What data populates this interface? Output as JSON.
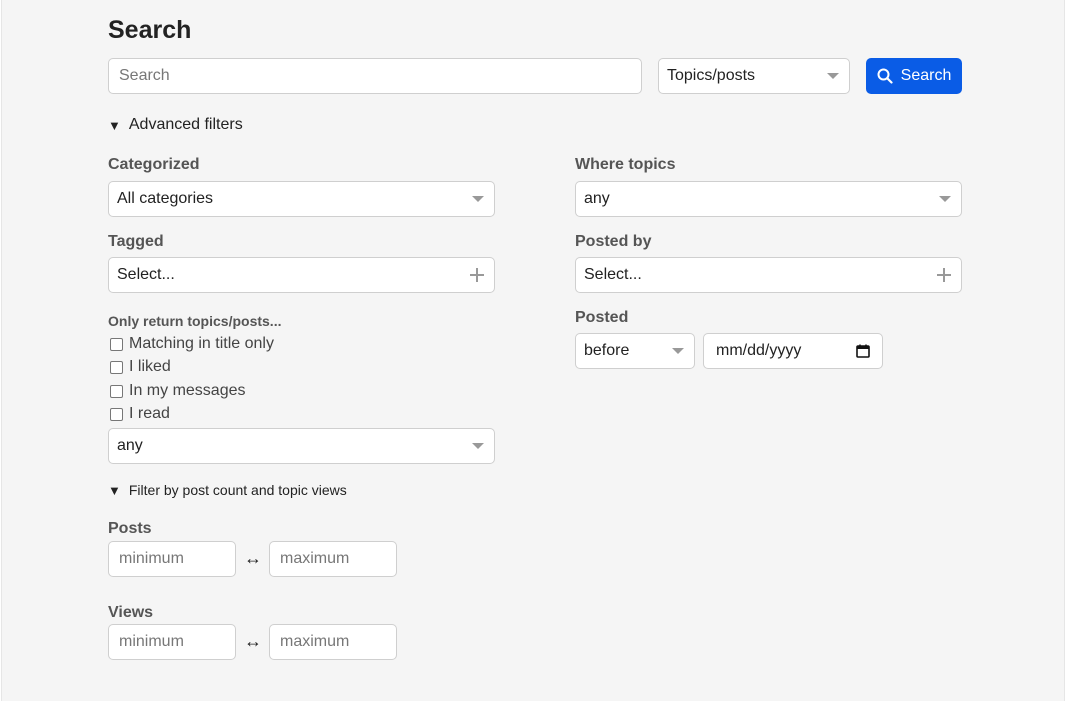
{
  "page_title": "Search",
  "search": {
    "placeholder": "Search",
    "type_selected": "Topics/posts",
    "button_label": "Search"
  },
  "advanced_toggle": "Advanced filters",
  "categorized": {
    "label": "Categorized",
    "value": "All categories"
  },
  "tagged": {
    "label": "Tagged",
    "value": "Select..."
  },
  "where_topics": {
    "label": "Where topics",
    "value": "any"
  },
  "posted_by": {
    "label": "Posted by",
    "value": "Select..."
  },
  "posted": {
    "label": "Posted",
    "when": "before",
    "date_placeholder": "mm/dd/yyyy"
  },
  "only_return": {
    "label": "Only return topics/posts...",
    "options": [
      "Matching in title only",
      "I liked",
      "In my messages",
      "I read"
    ],
    "select_value": "any"
  },
  "count_toggle": "Filter by post count and topic views",
  "posts": {
    "label": "Posts",
    "min_placeholder": "minimum",
    "max_placeholder": "maximum"
  },
  "views": {
    "label": "Views",
    "min_placeholder": "minimum",
    "max_placeholder": "maximum"
  },
  "colors": {
    "primary": "#0a5ce6",
    "background": "#f5f5f5"
  }
}
